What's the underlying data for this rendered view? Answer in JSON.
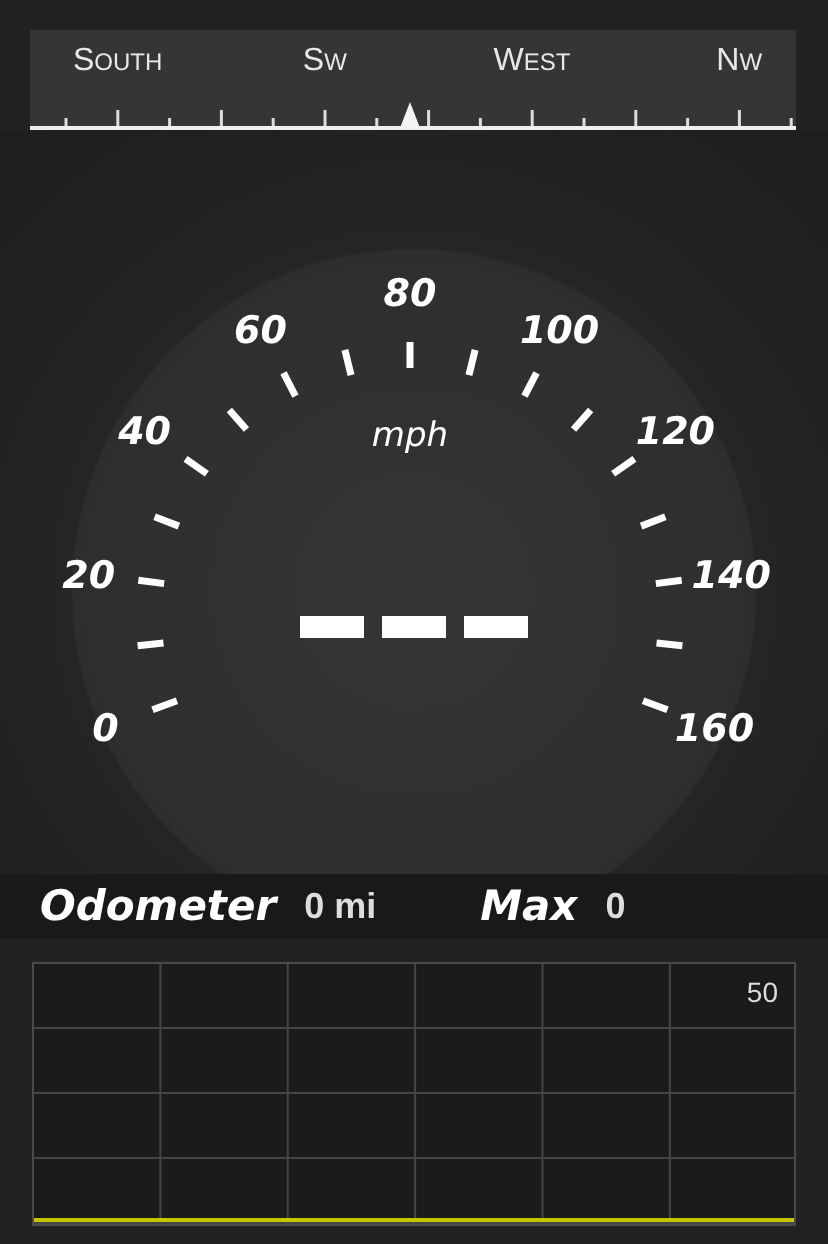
{
  "compass": {
    "headings": [
      {
        "label": "SOUTH"
      },
      {
        "label": "SW"
      },
      {
        "label": "WEST"
      },
      {
        "label": "NW"
      }
    ]
  },
  "speedometer": {
    "unit": "mph",
    "scale_labels": [
      "0",
      "20",
      "40",
      "60",
      "80",
      "100",
      "120",
      "140",
      "160"
    ]
  },
  "trip": {
    "odometer_label": "Odometer",
    "odometer_value": "0 mi",
    "max_label": "Max",
    "max_value": "0"
  },
  "graph": {
    "scale_label": "50"
  }
}
